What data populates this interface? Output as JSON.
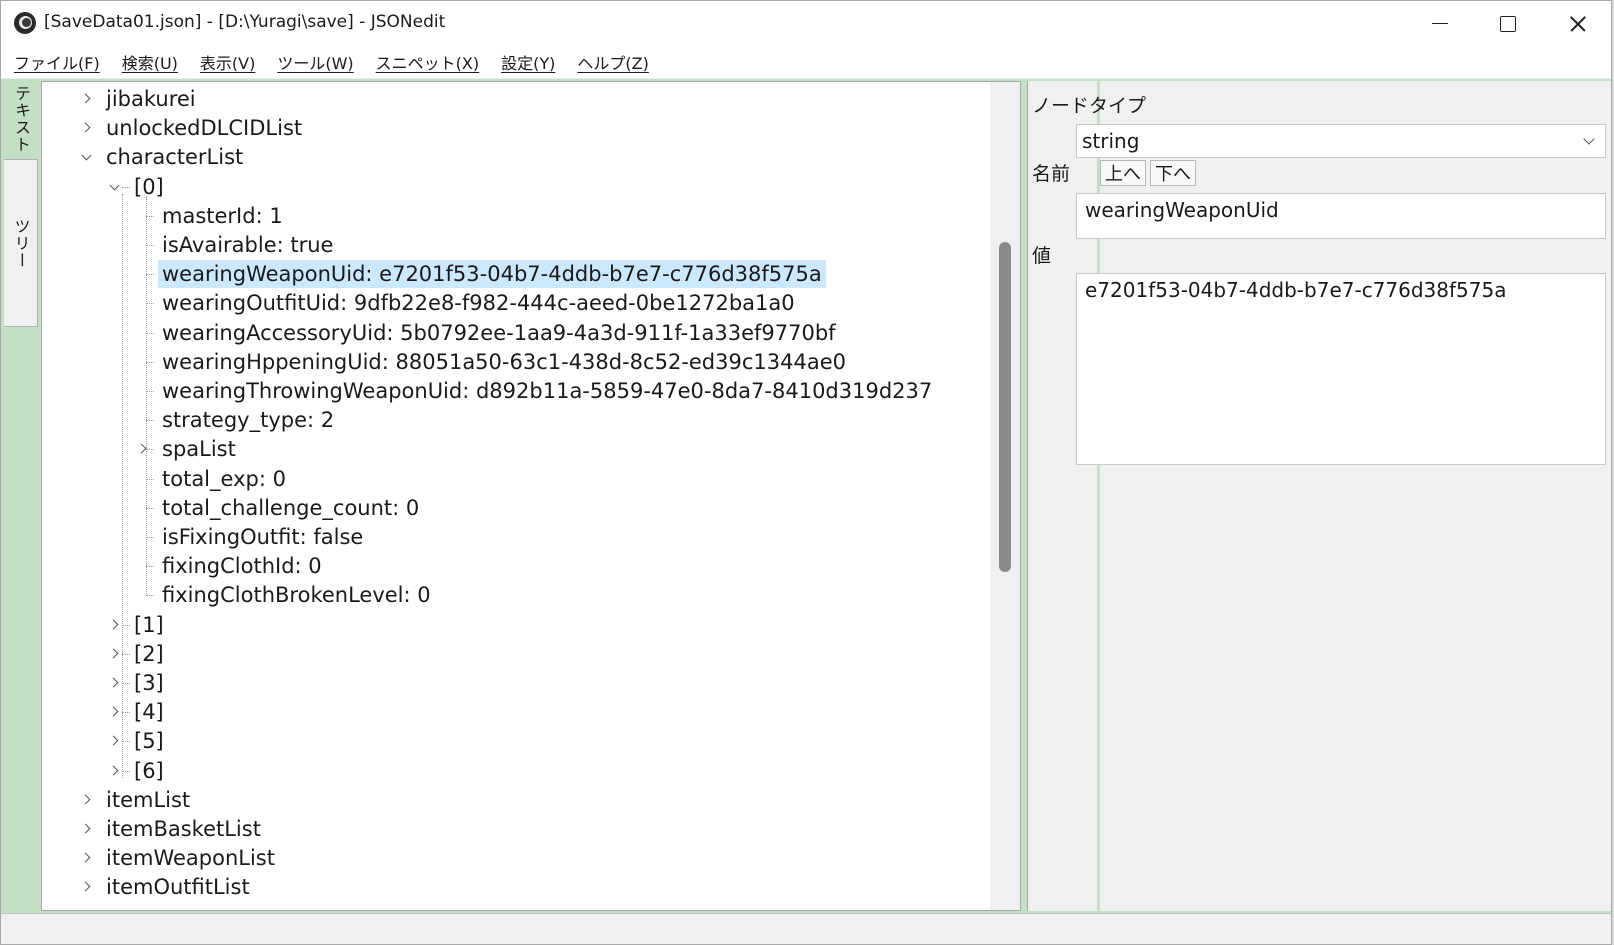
{
  "window": {
    "title": "[SaveData01.json] - [D:\\Yuragi\\save] - JSONedit",
    "icons": {
      "app": "jsonedit-app-icon",
      "minimize": "minimize-icon",
      "maximize": "maximize-icon",
      "close": "close-icon"
    }
  },
  "menu": [
    {
      "label": "ファイル(F)"
    },
    {
      "label": "検索(U)"
    },
    {
      "label": "表示(V)"
    },
    {
      "label": "ツール(W)"
    },
    {
      "label": "スニペット(X)"
    },
    {
      "label": "設定(Y)"
    },
    {
      "label": "ヘルプ(Z)"
    }
  ],
  "side_tabs": {
    "text": "テキスト",
    "tree": "ツリー",
    "active": "tree"
  },
  "tree": {
    "nodes": [
      {
        "label": "jibakurei",
        "level": 0,
        "state": "collapsed"
      },
      {
        "label": "unlockedDLCIDList",
        "level": 0,
        "state": "collapsed"
      },
      {
        "label": "characterList",
        "level": 0,
        "state": "expanded"
      },
      {
        "label": "[0]",
        "level": 1,
        "state": "expanded"
      },
      {
        "label": "masterId: 1",
        "level": 2,
        "state": "leaf"
      },
      {
        "label": "isAvairable: true",
        "level": 2,
        "state": "leaf"
      },
      {
        "label": "wearingWeaponUid: e7201f53-04b7-4ddb-b7e7-c776d38f575a",
        "level": 2,
        "state": "leaf",
        "selected": true
      },
      {
        "label": "wearingOutfitUid: 9dfb22e8-f982-444c-aeed-0be1272ba1a0",
        "level": 2,
        "state": "leaf"
      },
      {
        "label": "wearingAccessoryUid: 5b0792ee-1aa9-4a3d-911f-1a33ef9770bf",
        "level": 2,
        "state": "leaf"
      },
      {
        "label": "wearingHppeningUid: 88051a50-63c1-438d-8c52-ed39c1344ae0",
        "level": 2,
        "state": "leaf"
      },
      {
        "label": "wearingThrowingWeaponUid: d892b11a-5859-47e0-8da7-8410d319d237",
        "level": 2,
        "state": "leaf"
      },
      {
        "label": "strategy_type: 2",
        "level": 2,
        "state": "leaf"
      },
      {
        "label": "spaList",
        "level": 2,
        "state": "collapsed"
      },
      {
        "label": "total_exp: 0",
        "level": 2,
        "state": "leaf"
      },
      {
        "label": "total_challenge_count: 0",
        "level": 2,
        "state": "leaf"
      },
      {
        "label": "isFixingOutfit: false",
        "level": 2,
        "state": "leaf"
      },
      {
        "label": "fixingClothId: 0",
        "level": 2,
        "state": "leaf"
      },
      {
        "label": "fixingClothBrokenLevel: 0",
        "level": 2,
        "state": "leaf"
      },
      {
        "label": "[1]",
        "level": 1,
        "state": "collapsed"
      },
      {
        "label": "[2]",
        "level": 1,
        "state": "collapsed"
      },
      {
        "label": "[3]",
        "level": 1,
        "state": "collapsed"
      },
      {
        "label": "[4]",
        "level": 1,
        "state": "collapsed"
      },
      {
        "label": "[5]",
        "level": 1,
        "state": "collapsed"
      },
      {
        "label": "[6]",
        "level": 1,
        "state": "collapsed"
      },
      {
        "label": "itemList",
        "level": 0,
        "state": "collapsed"
      },
      {
        "label": "itemBasketList",
        "level": 0,
        "state": "collapsed"
      },
      {
        "label": "itemWeaponList",
        "level": 0,
        "state": "collapsed"
      },
      {
        "label": "itemOutfitList",
        "level": 0,
        "state": "collapsed"
      }
    ]
  },
  "props": {
    "node_type_label": "ノードタイプ",
    "node_type_value": "string",
    "name_label": "名前",
    "up_button": "上へ",
    "down_button": "下へ",
    "name_value": "wearingWeaponUid",
    "value_label": "値",
    "value_text": "e7201f53-04b7-4ddb-b7e7-c776d38f575a"
  },
  "colors": {
    "accent_green": "#c4e0c4",
    "selection": "#cce8ff"
  }
}
